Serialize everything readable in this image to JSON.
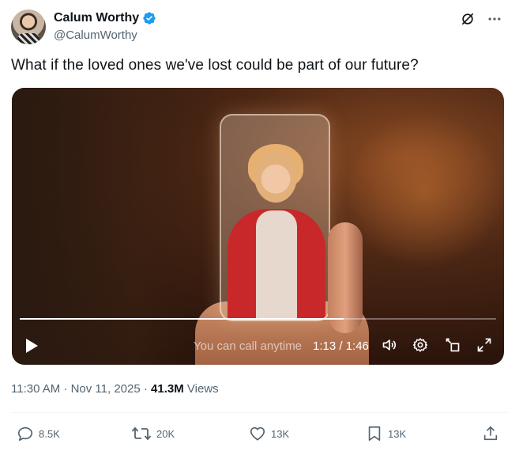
{
  "author": {
    "display_name": "Calum Worthy",
    "handle": "@CalumWorthy",
    "verified": true
  },
  "tweet": {
    "text": "What if the loved ones we've lost could be part of our future?"
  },
  "video": {
    "caption_overlay": "You can call anytime",
    "timecode": "1:13 / 1:46",
    "progress": 0.68
  },
  "meta": {
    "timestamp": "11:30 AM · Nov 11, 2025 · ",
    "views_count": "41.3M",
    "views_label": " Views"
  },
  "actions": {
    "replies": "8.5K",
    "reposts": "20K",
    "likes": "13K",
    "bookmarks": "13K"
  },
  "icons": {
    "verified": "verified-badge-icon",
    "grok": "grok-icon",
    "more": "more-icon",
    "play": "play-icon",
    "volume": "volume-icon",
    "settings": "settings-icon",
    "pip": "picture-in-picture-icon",
    "fullscreen": "fullscreen-icon",
    "reply": "reply-icon",
    "repost": "repost-icon",
    "like": "like-icon",
    "bookmark": "bookmark-icon",
    "share": "share-icon"
  },
  "colors": {
    "verified_blue": "#1d9bf0",
    "text_primary": "#0f1419",
    "text_secondary": "#536471"
  }
}
